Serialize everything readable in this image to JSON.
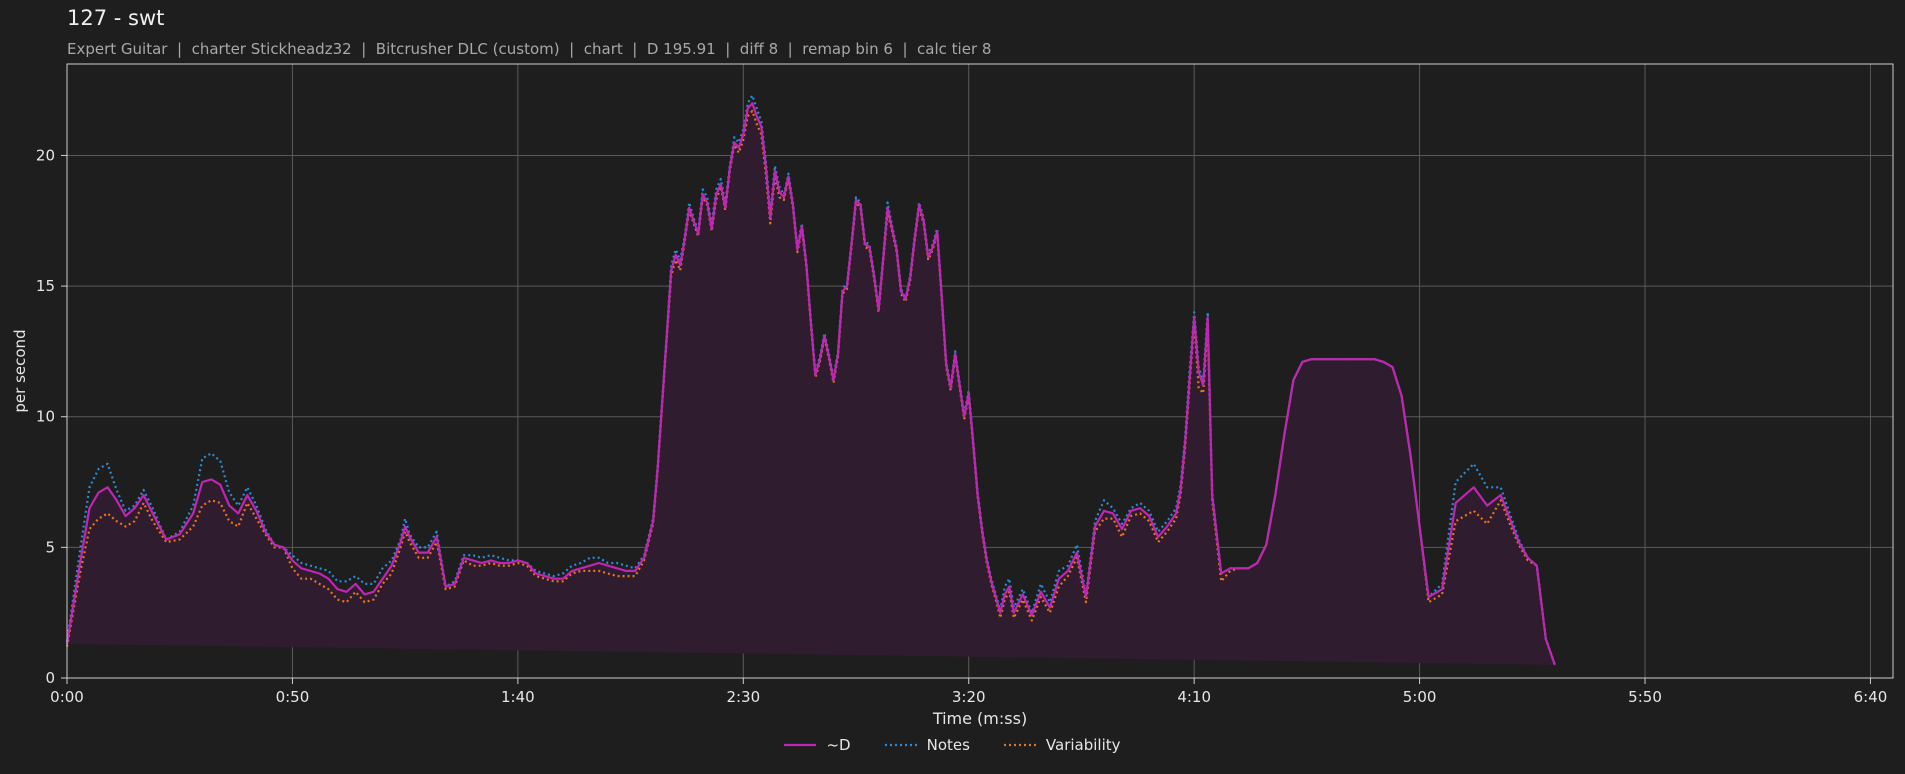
{
  "title": "127 - swt",
  "subtitle": "Expert Guitar  |  charter Stickheadz32  |  Bitcrusher DLC (custom)  |  chart  |  D 195.91  |  diff 8  |  remap bin 6  |  calc tier 8",
  "colors": {
    "background": "#1e1e1e",
    "grid": "#5a5a5a",
    "axis": "#cfcfcf",
    "text": "#e6e6e6",
    "fill": "#2f1c2e",
    "d": "#c026b4",
    "notes": "#2b8bd6",
    "variability": "#e8741e"
  },
  "chart_data": {
    "type": "line",
    "title": "127 - swt",
    "xlabel": "Time (m:ss)",
    "ylabel": "per second",
    "xlim": [
      0,
      405
    ],
    "ylim": [
      0,
      23.5
    ],
    "grid": true,
    "legend_position": "bottom-center",
    "x_ticks": [
      0,
      50,
      100,
      150,
      200,
      250,
      300,
      350,
      400
    ],
    "x_tick_labels": [
      "0:00",
      "0:50",
      "1:40",
      "2:30",
      "3:20",
      "4:10",
      "5:00",
      "5:50",
      "6:40"
    ],
    "y_ticks": [
      0,
      5,
      10,
      15,
      20
    ],
    "y_tick_labels": [
      "0",
      "5",
      "10",
      "15",
      "20"
    ],
    "x": [
      0,
      3,
      5,
      7,
      9,
      11,
      13,
      15,
      17,
      19,
      22,
      25,
      28,
      30,
      32,
      34,
      36,
      38,
      40,
      42,
      44,
      46,
      48,
      50,
      52,
      54,
      56,
      58,
      60,
      62,
      64,
      66,
      68,
      70,
      72,
      74,
      75,
      76,
      78,
      80,
      82,
      84,
      86,
      88,
      90,
      92,
      94,
      96,
      98,
      100,
      102,
      104,
      106,
      108,
      110,
      112,
      114,
      116,
      118,
      120,
      122,
      124,
      126,
      128,
      130,
      131,
      132,
      133,
      134,
      135,
      136,
      137,
      138,
      139,
      140,
      141,
      142,
      143,
      144,
      145,
      146,
      147,
      148,
      149,
      150,
      151,
      152,
      153,
      154,
      155,
      156,
      157,
      158,
      159,
      160,
      161,
      162,
      163,
      164,
      165,
      166,
      167,
      168,
      169,
      170,
      171,
      172,
      173,
      174,
      175,
      176,
      177,
      178,
      179,
      180,
      181,
      182,
      183,
      184,
      185,
      186,
      187,
      188,
      189,
      190,
      191,
      192,
      193,
      194,
      195,
      196,
      197,
      198,
      199,
      200,
      201,
      202,
      203,
      204,
      205,
      206,
      207,
      208,
      209,
      210,
      212,
      214,
      216,
      218,
      220,
      222,
      224,
      226,
      228,
      230,
      232,
      234,
      236,
      238,
      240,
      242,
      244,
      246,
      247,
      248,
      249,
      250,
      251,
      252,
      253,
      254,
      256,
      258,
      260,
      262,
      264,
      266,
      268,
      270,
      272,
      274,
      276,
      278,
      279,
      280,
      282,
      284,
      285,
      286,
      288,
      290,
      292,
      294,
      296,
      298,
      300,
      302,
      305,
      308,
      312,
      315,
      318,
      320,
      322,
      324,
      326,
      328,
      330,
      332,
      335,
      340,
      345,
      350,
      355,
      360,
      365,
      370,
      375,
      380,
      383,
      386,
      388,
      390,
      392,
      394,
      396,
      398,
      400,
      402,
      404,
      405
    ],
    "series": [
      {
        "name": "~D",
        "style": "solid",
        "values": [
          1.3,
          4.5,
          6.5,
          7.1,
          7.3,
          6.8,
          6.2,
          6.5,
          7.0,
          6.3,
          5.3,
          5.5,
          6.3,
          7.5,
          7.6,
          7.4,
          6.6,
          6.3,
          7.0,
          6.4,
          5.6,
          5.1,
          5.0,
          4.5,
          4.2,
          4.1,
          4.0,
          3.8,
          3.4,
          3.3,
          3.6,
          3.2,
          3.3,
          3.8,
          4.3,
          5.2,
          5.8,
          5.4,
          4.8,
          4.8,
          5.4,
          3.5,
          3.6,
          4.6,
          4.5,
          4.4,
          4.5,
          4.4,
          4.4,
          4.5,
          4.4,
          4.0,
          3.9,
          3.8,
          3.8,
          4.1,
          4.2,
          4.3,
          4.4,
          4.3,
          4.2,
          4.1,
          4.1,
          4.6,
          6.0,
          8.0,
          10.5,
          13.0,
          15.6,
          16.2,
          15.8,
          16.8,
          18.0,
          17.5,
          17.0,
          18.5,
          18.2,
          17.2,
          18.5,
          18.9,
          18.0,
          19.5,
          20.5,
          20.3,
          20.8,
          21.8,
          22.0,
          21.5,
          21.1,
          19.6,
          17.6,
          19.4,
          18.6,
          18.4,
          19.2,
          18.1,
          16.4,
          17.3,
          15.8,
          13.6,
          11.6,
          12.2,
          13.1,
          12.3,
          11.4,
          12.4,
          14.8,
          15.0,
          16.6,
          18.3,
          18.1,
          16.6,
          16.5,
          15.4,
          14.1,
          16.0,
          18.0,
          17.2,
          16.4,
          14.8,
          14.5,
          15.3,
          16.8,
          18.1,
          17.5,
          16.1,
          16.5,
          17.1,
          14.6,
          12.0,
          11.1,
          12.4,
          11.2,
          10.0,
          10.9,
          9.0,
          7.0,
          5.6,
          4.5,
          3.7,
          3.1,
          2.5,
          3.2,
          3.5,
          2.5,
          3.2,
          2.4,
          3.3,
          2.7,
          3.8,
          4.1,
          4.8,
          3.1,
          5.8,
          6.4,
          6.3,
          5.7,
          6.4,
          6.5,
          6.2,
          5.4,
          5.8,
          6.3,
          7.2,
          9.0,
          11.5,
          13.8,
          11.7,
          11.2,
          13.8,
          7.0,
          4.0,
          4.2,
          4.2,
          4.2,
          4.4,
          5.1,
          7.0,
          9.3,
          11.4,
          12.1,
          12.2,
          12.2,
          12.2,
          12.2,
          12.2,
          12.2,
          12.2,
          12.2,
          12.2,
          12.2,
          12.1,
          11.9,
          10.8,
          8.5,
          5.8,
          3.1,
          3.4,
          6.7,
          7.3,
          6.6,
          7.0,
          6.1,
          5.2,
          4.6,
          4.3,
          1.5,
          0.5
        ]
      },
      {
        "name": "Notes",
        "style": "dotted",
        "values": [
          1.4,
          5.0,
          7.3,
          8.0,
          8.2,
          7.2,
          6.4,
          6.6,
          7.2,
          6.5,
          5.3,
          5.6,
          6.6,
          8.4,
          8.6,
          8.3,
          7.1,
          6.6,
          7.3,
          6.6,
          5.7,
          5.1,
          5.0,
          4.7,
          4.4,
          4.3,
          4.2,
          4.1,
          3.7,
          3.7,
          3.9,
          3.6,
          3.6,
          4.2,
          4.5,
          5.3,
          6.1,
          5.5,
          5.0,
          5.0,
          5.6,
          3.5,
          3.7,
          4.7,
          4.7,
          4.6,
          4.7,
          4.6,
          4.5,
          4.5,
          4.4,
          4.1,
          4.0,
          3.9,
          4.0,
          4.3,
          4.4,
          4.6,
          4.6,
          4.4,
          4.4,
          4.3,
          4.2,
          4.7,
          6.1,
          8.1,
          10.6,
          13.1,
          15.8,
          16.4,
          16.0,
          16.9,
          18.2,
          17.6,
          17.1,
          18.7,
          18.4,
          17.4,
          18.7,
          19.1,
          18.2,
          19.6,
          20.7,
          20.5,
          21.0,
          22.0,
          22.3,
          21.8,
          21.3,
          19.8,
          17.8,
          19.6,
          18.8,
          18.5,
          19.3,
          18.2,
          16.5,
          17.4,
          15.9,
          13.7,
          11.7,
          12.3,
          13.2,
          12.4,
          11.5,
          12.5,
          14.9,
          15.1,
          16.7,
          18.4,
          18.2,
          16.7,
          16.6,
          15.5,
          14.2,
          16.1,
          18.2,
          17.3,
          16.5,
          14.9,
          14.5,
          15.4,
          16.9,
          18.2,
          17.6,
          16.2,
          16.6,
          17.2,
          14.7,
          12.1,
          11.2,
          12.5,
          11.3,
          10.1,
          11.0,
          9.1,
          7.1,
          5.7,
          4.6,
          3.8,
          3.2,
          2.6,
          3.5,
          3.8,
          2.7,
          3.4,
          2.5,
          3.6,
          2.9,
          4.1,
          4.3,
          5.1,
          3.2,
          6.0,
          6.8,
          6.5,
          5.9,
          6.5,
          6.7,
          6.4,
          5.6,
          6.0,
          6.5,
          7.4,
          9.2,
          11.8,
          14.0,
          11.9,
          11.4,
          14.0,
          7.1,
          4.0,
          4.2,
          4.2,
          4.2,
          4.4,
          5.1,
          7.0,
          9.3,
          11.4,
          12.1,
          12.2,
          12.2,
          12.2,
          12.2,
          12.2,
          12.2,
          12.2,
          12.2,
          12.2,
          12.2,
          12.1,
          11.9,
          10.8,
          8.5,
          5.8,
          3.1,
          3.6,
          7.5,
          8.2,
          7.3,
          7.3,
          6.3,
          5.3,
          4.6,
          4.3,
          1.5,
          0.5
        ]
      },
      {
        "name": "Variability",
        "style": "dotted",
        "values": [
          1.2,
          4.1,
          5.7,
          6.1,
          6.3,
          6.0,
          5.8,
          6.0,
          6.7,
          6.0,
          5.2,
          5.3,
          5.8,
          6.6,
          6.8,
          6.7,
          6.0,
          5.8,
          6.7,
          6.1,
          5.5,
          5.0,
          5.0,
          4.2,
          3.8,
          3.8,
          3.6,
          3.4,
          3.0,
          2.9,
          3.3,
          2.9,
          3.0,
          3.6,
          4.0,
          5.0,
          5.6,
          5.2,
          4.6,
          4.6,
          5.2,
          3.4,
          3.5,
          4.5,
          4.3,
          4.3,
          4.4,
          4.3,
          4.3,
          4.4,
          4.3,
          3.9,
          3.8,
          3.7,
          3.7,
          4.0,
          4.1,
          4.1,
          4.1,
          4.0,
          3.9,
          3.9,
          3.9,
          4.5,
          5.9,
          7.9,
          10.4,
          12.9,
          15.4,
          16.0,
          15.6,
          16.7,
          17.9,
          17.4,
          16.9,
          18.4,
          18.1,
          17.1,
          18.3,
          18.8,
          17.9,
          19.4,
          20.4,
          20.1,
          20.6,
          21.5,
          21.7,
          21.2,
          20.8,
          19.3,
          17.4,
          19.2,
          18.4,
          18.3,
          19.1,
          18.0,
          16.3,
          17.2,
          15.7,
          13.5,
          11.5,
          12.1,
          13.0,
          12.2,
          11.3,
          12.3,
          14.7,
          14.9,
          16.5,
          18.2,
          18.0,
          16.5,
          16.4,
          15.3,
          14.0,
          15.9,
          17.8,
          17.1,
          16.3,
          14.7,
          14.4,
          15.2,
          16.7,
          18.0,
          17.4,
          16.0,
          16.4,
          17.0,
          14.5,
          11.9,
          11.0,
          12.3,
          11.1,
          9.9,
          10.8,
          8.9,
          6.9,
          5.5,
          4.4,
          3.6,
          3.0,
          2.3,
          3.0,
          3.3,
          2.3,
          3.0,
          2.2,
          3.1,
          2.5,
          3.5,
          3.9,
          4.6,
          2.9,
          5.6,
          6.1,
          6.1,
          5.4,
          6.2,
          6.3,
          6.0,
          5.2,
          5.6,
          6.1,
          7.0,
          8.8,
          11.3,
          13.6,
          11.1,
          10.9,
          13.5,
          6.8,
          3.7,
          4.1,
          4.2,
          4.2,
          4.4,
          5.1,
          7.0,
          9.3,
          11.4,
          12.1,
          12.2,
          12.2,
          12.2,
          12.2,
          12.2,
          12.2,
          12.2,
          12.2,
          12.2,
          12.2,
          12.1,
          11.9,
          10.8,
          8.5,
          5.8,
          2.9,
          3.2,
          6.0,
          6.4,
          5.9,
          6.8,
          5.9,
          5.1,
          4.5,
          4.3,
          1.5,
          0.5
        ]
      }
    ]
  },
  "legend": [
    {
      "label": "~D",
      "style": "solid",
      "color": "#c026b4"
    },
    {
      "label": "Notes",
      "style": "dotted",
      "color": "#2b8bd6"
    },
    {
      "label": "Variability",
      "style": "dotted",
      "color": "#e8741e"
    }
  ]
}
